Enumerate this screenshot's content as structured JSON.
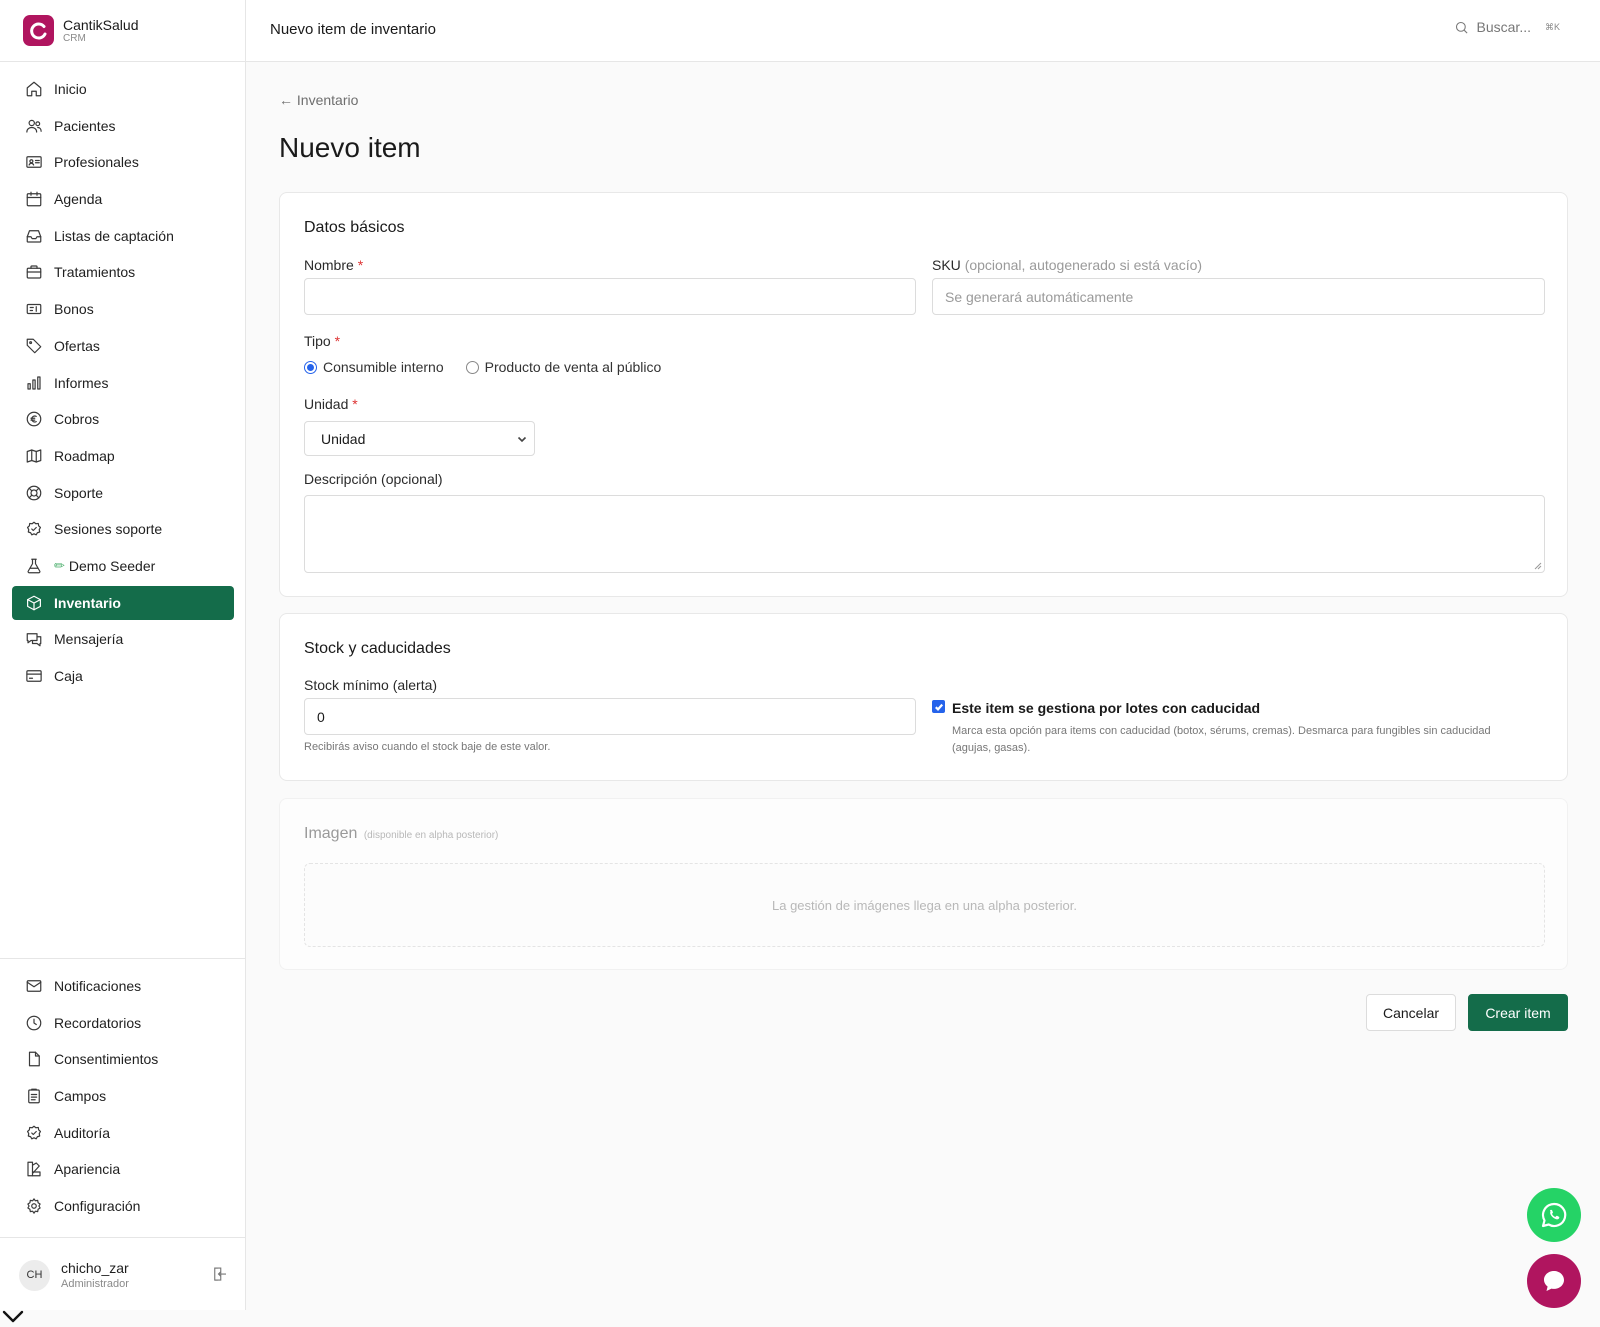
{
  "brand": {
    "name": "CantikSalud",
    "sub": "CRM"
  },
  "sidebar": {
    "items": [
      {
        "label": "Inicio",
        "icon": "home-icon"
      },
      {
        "label": "Pacientes",
        "icon": "users-icon"
      },
      {
        "label": "Profesionales",
        "icon": "id-card-icon"
      },
      {
        "label": "Agenda",
        "icon": "calendar-icon"
      },
      {
        "label": "Listas de captación",
        "icon": "inbox-icon"
      },
      {
        "label": "Tratamientos",
        "icon": "briefcase-icon"
      },
      {
        "label": "Bonos",
        "icon": "ticket-icon"
      },
      {
        "label": "Ofertas",
        "icon": "tag-icon"
      },
      {
        "label": "Informes",
        "icon": "bar-chart-icon"
      },
      {
        "label": "Cobros",
        "icon": "euro-icon"
      },
      {
        "label": "Roadmap",
        "icon": "map-icon"
      },
      {
        "label": "Soporte",
        "icon": "lifebuoy-icon"
      },
      {
        "label": "Sesiones soporte",
        "icon": "shield-check-icon"
      },
      {
        "label": "Demo Seeder",
        "icon": "flask-icon",
        "prefix": "✏"
      },
      {
        "label": "Inventario",
        "icon": "box-icon",
        "active": true
      },
      {
        "label": "Mensajería",
        "icon": "messages-icon"
      },
      {
        "label": "Caja",
        "icon": "credit-card-icon"
      }
    ],
    "bottom_items": [
      {
        "label": "Notificaciones",
        "icon": "mail-icon"
      },
      {
        "label": "Recordatorios",
        "icon": "clock-icon"
      },
      {
        "label": "Consentimientos",
        "icon": "file-icon"
      },
      {
        "label": "Campos",
        "icon": "clipboard-icon"
      },
      {
        "label": "Auditoría",
        "icon": "shield-check-icon"
      },
      {
        "label": "Apariencia",
        "icon": "palette-icon"
      },
      {
        "label": "Configuración",
        "icon": "gear-icon"
      }
    ]
  },
  "user": {
    "initials": "CH",
    "name": "chicho_zar",
    "role": "Administrador"
  },
  "topbar": {
    "title": "Nuevo item de inventario",
    "search_label": "Buscar...",
    "shortcut": "⌘K"
  },
  "main": {
    "back_label": "← Inventario",
    "title": "Nuevo item",
    "basic": {
      "title": "Datos básicos",
      "name_label": "Nombre",
      "name_value": "",
      "sku_label": "SKU",
      "sku_hint": "(opcional, autogenerado si está vacío)",
      "sku_placeholder": "Se generará automáticamente",
      "type_label": "Tipo",
      "type_options": [
        "Consumible interno",
        "Producto de venta al público"
      ],
      "type_selected": "Consumible interno",
      "unit_label": "Unidad",
      "unit_value": "Unidad",
      "desc_label": "Descripción (opcional)",
      "desc_value": ""
    },
    "stock": {
      "title": "Stock y caducidades",
      "min_label": "Stock mínimo (alerta)",
      "min_value": "0",
      "min_hint": "Recibirás aviso cuando el stock baje de este valor.",
      "lots_checked": true,
      "lots_label": "Este item se gestiona por lotes con caducidad",
      "lots_desc": "Marca esta opción para items con caducidad (botox, sérums, cremas). Desmarca para fungibles sin caducidad (agujas, gasas)."
    },
    "image": {
      "title": "Imagen",
      "sub": "(disponible en alpha posterior)",
      "placeholder": "La gestión de imágenes llega en una alpha posterior."
    },
    "actions": {
      "cancel": "Cancelar",
      "create": "Crear item"
    }
  },
  "colors": {
    "primary": "#146c4a",
    "brand": "#b0155f",
    "whatsapp": "#25d366",
    "radio": "#2563eb"
  }
}
